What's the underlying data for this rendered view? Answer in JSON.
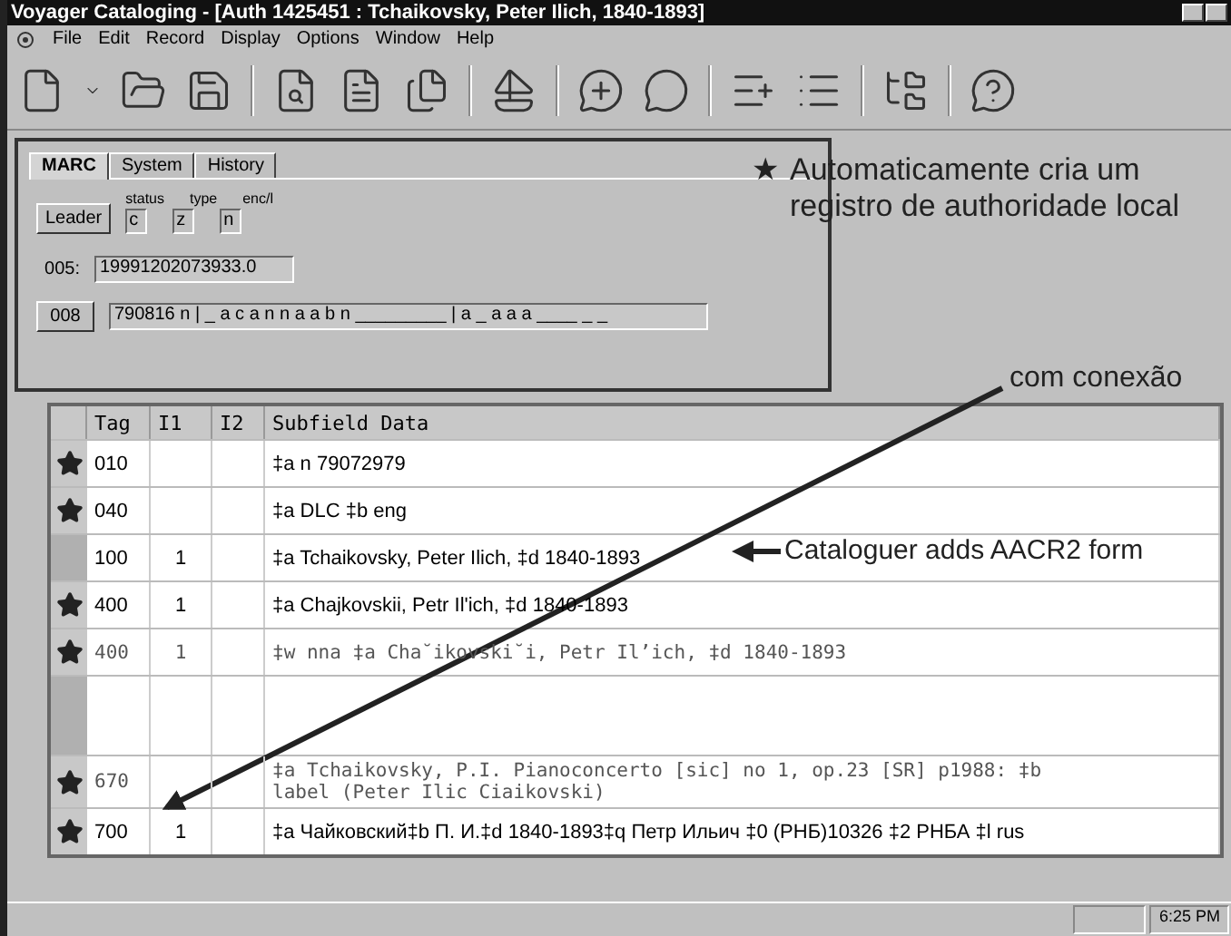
{
  "window": {
    "title": "Voyager Cataloging - [Auth 1425451 : Tchaikovsky, Peter Ilich, 1840-1893]"
  },
  "menu": [
    "File",
    "Edit",
    "Record",
    "Display",
    "Options",
    "Window",
    "Help"
  ],
  "tabs": [
    {
      "label": "MARC",
      "selected": true
    },
    {
      "label": "System",
      "selected": false
    },
    {
      "label": "History",
      "selected": false
    }
  ],
  "leader": {
    "button": "Leader",
    "labels": [
      "status",
      "type",
      "enc/l"
    ],
    "values": [
      "c",
      "z",
      "n"
    ]
  },
  "field_005": {
    "label": "005:",
    "value": "19991202073933.0"
  },
  "field_008": {
    "button": "008",
    "value": "790816 n | _ a c a n n a a b n _________ | a _ a a a ____ _ _"
  },
  "table": {
    "columns": [
      "Tag",
      "I1",
      "I2",
      "Subfield Data"
    ],
    "rows": [
      {
        "kind": "sans",
        "starred": true,
        "tag": "010",
        "data": "‡a n    79072979"
      },
      {
        "kind": "sans",
        "starred": true,
        "tag": "040",
        "data": "‡a DLC ‡b eng"
      },
      {
        "kind": "sans",
        "starred": false,
        "tag": "100",
        "i1": "1",
        "data": "‡a Tchaikovsky, Peter Ilich, ‡d 1840-1893"
      },
      {
        "kind": "sans",
        "starred": true,
        "tag": "400",
        "i1": "1",
        "data": "‡a Chajkovskii, Petr Il'ich, ‡d 1840-1893"
      },
      {
        "kind": "mono",
        "starred": true,
        "tag": "400",
        "i1": "1",
        "data": "‡w nna ‡a Cha˘ikovski˘i, Petr Il’ich, ‡d 1840-1893"
      },
      {
        "kind": "blank",
        "starred": false
      },
      {
        "kind": "mono",
        "starred": true,
        "tag": "670",
        "data": "‡a Tchaikovsky, P.I. Pianoconcerto [sic] no 1, op.23 [SR] p1988: ‡b label (Peter Ilic Ciaikovski)"
      },
      {
        "kind": "sans",
        "starred": true,
        "tag": "700",
        "i1": "1",
        "data": "‡a Чайковский‡b П. И.‡d 1840-1893‡q Петр Ильич ‡0 (РНБ)10326 ‡2 РНБА ‡l rus"
      }
    ]
  },
  "annotations": {
    "note_mark": "★",
    "note": "Automaticamente cria um registro de authoridade local",
    "link": "com conexão",
    "callout": "Cataloguer adds AACR2 form"
  },
  "status_bar": {
    "time": "6:25 PM"
  }
}
